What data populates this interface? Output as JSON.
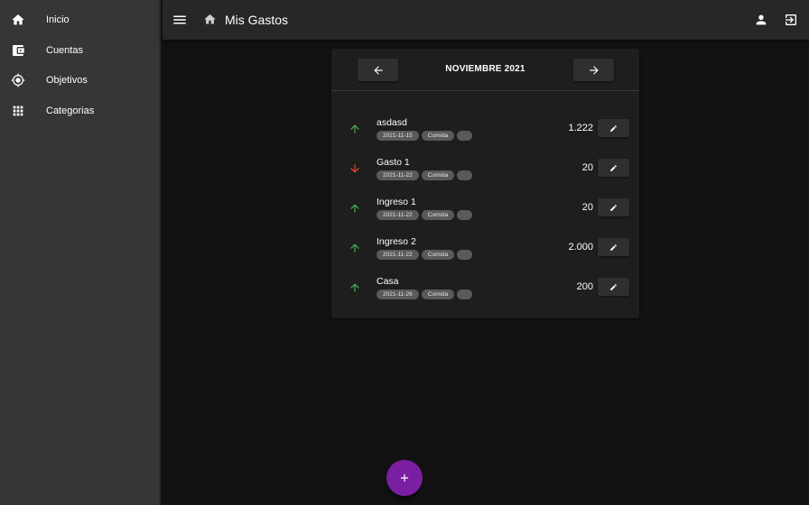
{
  "sidebar": {
    "items": [
      {
        "label": "Inicio",
        "icon": "home-icon"
      },
      {
        "label": "Cuentas",
        "icon": "wallet-icon"
      },
      {
        "label": "Objetivos",
        "icon": "target-icon"
      },
      {
        "label": "Categorias",
        "icon": "grid-icon"
      }
    ]
  },
  "header": {
    "title": "Mis Gastos",
    "icons": [
      "menu-icon",
      "home-icon",
      "account-icon",
      "logout-icon"
    ]
  },
  "month_nav": {
    "label": "NOVIEMBRE 2021"
  },
  "transactions": [
    {
      "name": "asdasd",
      "date": "2021-11-15",
      "category": "Comida",
      "amount": "1.222",
      "direction": "up"
    },
    {
      "name": "Gasto 1",
      "date": "2021-11-22",
      "category": "Comida",
      "amount": "20",
      "direction": "down"
    },
    {
      "name": "Ingreso 1",
      "date": "2021-11-22",
      "category": "Comida",
      "amount": "20",
      "direction": "up"
    },
    {
      "name": "Ingreso 2",
      "date": "2021-11-22",
      "category": "Comida",
      "amount": "2.000",
      "direction": "up"
    },
    {
      "name": "Casa",
      "date": "2021-11-26",
      "category": "Comida",
      "amount": "200",
      "direction": "up"
    }
  ],
  "colors": {
    "income": "#4caf50",
    "expense": "#f44336",
    "fab": "#7b1fa2",
    "sidebar": "#363636",
    "topbar": "#272727",
    "card": "#1e1e1e"
  }
}
